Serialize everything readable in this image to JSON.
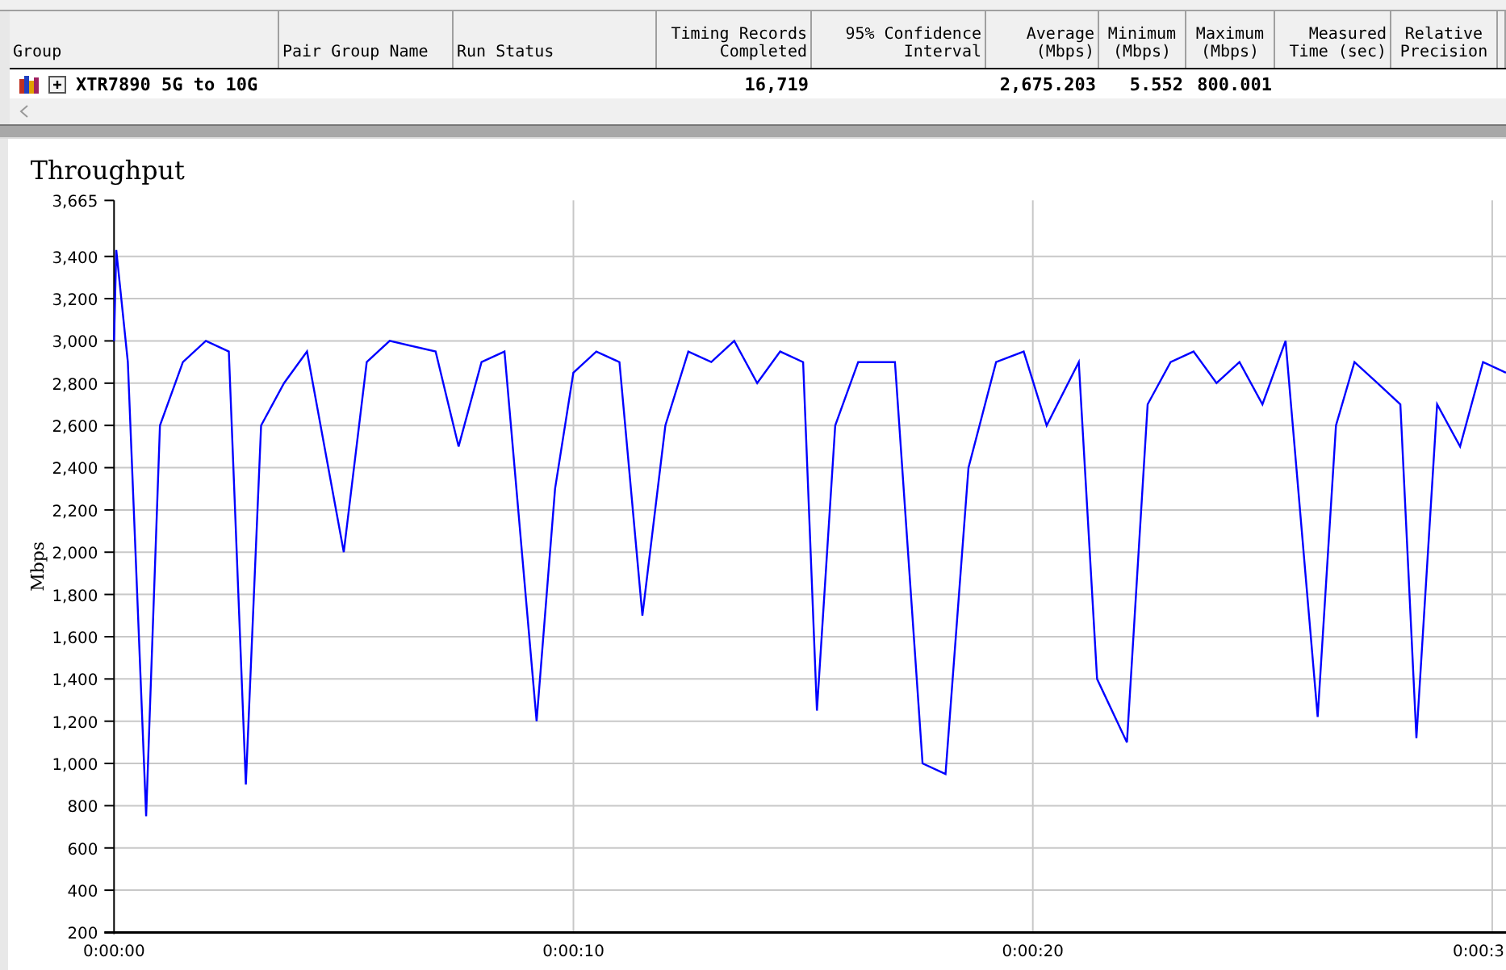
{
  "table": {
    "columns": [
      {
        "label": "Group"
      },
      {
        "label": "Pair Group Name"
      },
      {
        "label": "Run Status"
      },
      {
        "label": "Timing Records Completed"
      },
      {
        "label": "95% Confidence Interval"
      },
      {
        "label": "Average (Mbps)"
      },
      {
        "label": "Minimum (Mbps)"
      },
      {
        "label": "Maximum (Mbps)"
      },
      {
        "label": "Measured Time (sec)"
      },
      {
        "label": "Relative Precision"
      }
    ],
    "rows": [
      {
        "expanded": false,
        "group": "XTR7890 5G to 10G",
        "timing_records": "16,719",
        "average": "2,675.203",
        "minimum": "5.552",
        "maximum": "800.001"
      }
    ]
  },
  "chart": {
    "chart_data": {
      "type": "line",
      "title": "Throughput",
      "ylabel": "Mbps",
      "xlim": [
        0,
        30.3
      ],
      "ylim": [
        200,
        3665
      ],
      "grid": true,
      "xticks": [
        {
          "value": 0,
          "label": "0:00:00"
        },
        {
          "value": 10,
          "label": "0:00:10"
        },
        {
          "value": 20,
          "label": "0:00:20"
        },
        {
          "value": 30,
          "label": "0:00:3"
        }
      ],
      "yticks": [
        {
          "value": 200,
          "label": "200"
        },
        {
          "value": 400,
          "label": "400"
        },
        {
          "value": 600,
          "label": "600"
        },
        {
          "value": 800,
          "label": "800"
        },
        {
          "value": 1000,
          "label": "1,000"
        },
        {
          "value": 1200,
          "label": "1,200"
        },
        {
          "value": 1400,
          "label": "1,400"
        },
        {
          "value": 1600,
          "label": "1,600"
        },
        {
          "value": 1800,
          "label": "1,800"
        },
        {
          "value": 2000,
          "label": "2,000"
        },
        {
          "value": 2200,
          "label": "2,200"
        },
        {
          "value": 2400,
          "label": "2,400"
        },
        {
          "value": 2600,
          "label": "2,600"
        },
        {
          "value": 2800,
          "label": "2,800"
        },
        {
          "value": 3000,
          "label": "3,000"
        },
        {
          "value": 3200,
          "label": "3,200"
        },
        {
          "value": 3400,
          "label": "3,400"
        },
        {
          "value": 3665,
          "label": "3,665"
        }
      ],
      "x": [
        0,
        0.05,
        0.3,
        0.7,
        1.0,
        1.5,
        2.0,
        2.5,
        2.87,
        3.2,
        3.7,
        4.2,
        5.0,
        5.5,
        6.0,
        7.0,
        7.5,
        8.0,
        8.5,
        9.2,
        9.6,
        10.0,
        10.5,
        11.0,
        11.5,
        12.0,
        12.5,
        13.0,
        13.5,
        14.0,
        14.5,
        15.0,
        15.3,
        15.7,
        16.2,
        17.0,
        17.6,
        18.1,
        18.6,
        19.2,
        19.8,
        20.3,
        21.0,
        21.4,
        22.05,
        22.5,
        23.0,
        23.5,
        24.0,
        24.5,
        25.0,
        25.5,
        26.2,
        26.6,
        27.0,
        27.5,
        28.0,
        28.35,
        28.8,
        29.3,
        29.8,
        30.3
      ],
      "series": [
        {
          "color": "#0000ff",
          "values": [
            3000,
            3430,
            2900,
            750,
            2600,
            2900,
            3000,
            2950,
            900,
            2600,
            2800,
            2950,
            2000,
            2900,
            3000,
            2950,
            2500,
            2900,
            2950,
            1200,
            2300,
            2850,
            2950,
            2900,
            1700,
            2600,
            2950,
            2900,
            3000,
            2800,
            2950,
            2900,
            1250,
            2600,
            2900,
            2900,
            1000,
            950,
            2400,
            2900,
            2950,
            2600,
            2900,
            1400,
            1100,
            2700,
            2900,
            2950,
            2800,
            2900,
            2700,
            3000,
            1220,
            2600,
            2900,
            2800,
            2700,
            1120,
            2700,
            2500,
            2900,
            2850
          ]
        }
      ]
    }
  }
}
